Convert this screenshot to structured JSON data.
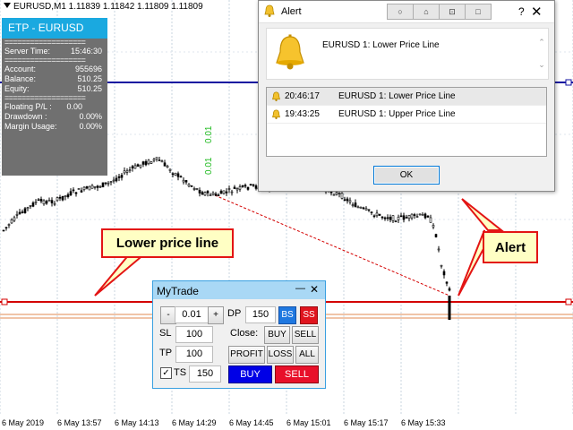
{
  "chart": {
    "symbol_line": "EURUSD,M1  1.11839 1.11842 1.11809 1.11809",
    "x_ticks": [
      "6 May 2019",
      "6 May 13:57",
      "6 May 14:13",
      "6 May 14:29",
      "6 May 14:45",
      "6 May 15:01",
      "6 May 15:17",
      "6 May 15:33"
    ],
    "rotated_labels": [
      "0.01",
      "0.01"
    ],
    "colors": {
      "upper_line": "#1111a0",
      "lower_line": "#d40000",
      "sl_line": "#e08a50",
      "grid": "#c9d4df",
      "rotated_label": "#22bb22"
    }
  },
  "etp": {
    "title": "ETP - EURUSD",
    "separator": "===================",
    "server_time_label": "Server Time:",
    "server_time": "15:46:30",
    "account_label": "Account:",
    "account": "955696",
    "balance_label": "Balance:",
    "balance": "510.25",
    "equity_label": "Equity:",
    "equity": "510.25",
    "floating_label": "Floating P/L :",
    "floating": "0.00",
    "drawdown_label": "Drawdown :",
    "drawdown": "0.00%",
    "margin_label": "Margin Usage:",
    "margin": "0.00%"
  },
  "callouts": {
    "lower": "Lower price line",
    "alert": "Alert"
  },
  "alert": {
    "title": "Alert",
    "title_buttons": [
      "○",
      "⌂",
      "⊡",
      "□"
    ],
    "help": "?",
    "close": "✕",
    "message": "EURUSD 1: Lower Price Line",
    "rows": [
      {
        "time": "20:46:17",
        "text": "EURUSD 1: Lower Price Line"
      },
      {
        "time": "19:43:25",
        "text": "EURUSD 1: Upper Price Line"
      }
    ],
    "ok": "OK"
  },
  "mytrade": {
    "title": "MyTrade",
    "minus": "-",
    "lot": "0.01",
    "plus": "+",
    "dp_label": "DP",
    "dp_value": "150",
    "bs": "BS",
    "ss": "SS",
    "sl_label": "SL",
    "sl_value": "100",
    "close_label": "Close:",
    "close_buy": "BUY",
    "close_sell": "SELL",
    "tp_label": "TP",
    "tp_value": "100",
    "profit": "PROFIT",
    "loss": "LOSS",
    "all": "ALL",
    "ts_label": "TS",
    "ts_value": "150",
    "buy": "BUY",
    "sell": "SELL",
    "colors": {
      "bs_bg": "#1f78e0",
      "ss_bg": "#e0141e",
      "buy_bg": "#0000e6",
      "sell_bg": "#e8102a"
    }
  }
}
